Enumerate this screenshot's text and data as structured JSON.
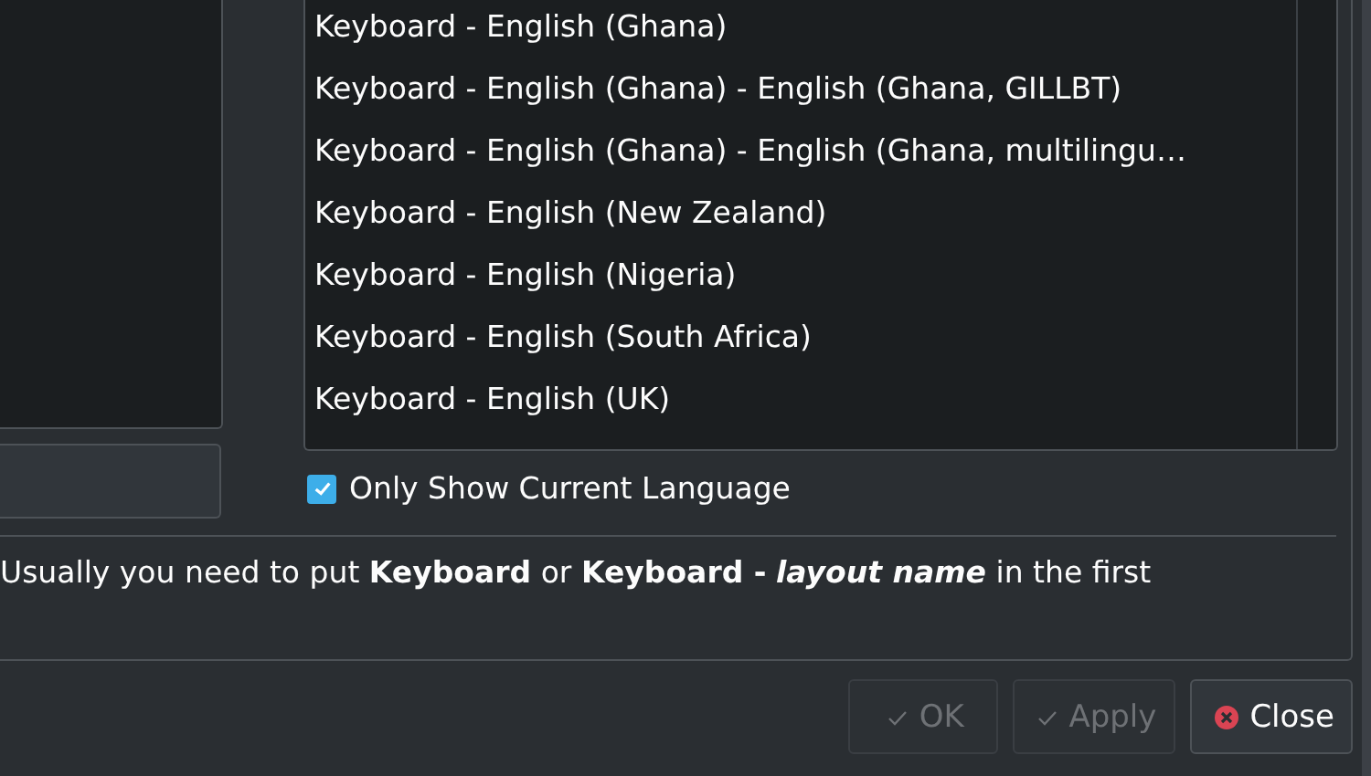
{
  "layout_list": {
    "items": [
      {
        "label": "Keyboard - English (Ghana)",
        "selected": false
      },
      {
        "label": "Keyboard - English (Ghana) - English (Ghana, GILLBT)",
        "selected": false
      },
      {
        "label": "Keyboard - English (Ghana) - English (Ghana, multilingu…",
        "selected": false
      },
      {
        "label": "Keyboard - English (New Zealand)",
        "selected": false
      },
      {
        "label": "Keyboard - English (Nigeria)",
        "selected": false
      },
      {
        "label": "Keyboard - English (South Africa)",
        "selected": false
      },
      {
        "label": "Keyboard - English (UK)",
        "selected": false
      }
    ]
  },
  "only_current_language": {
    "label": "Only Show Current Language",
    "checked": true
  },
  "hint": "Usually you need to put **Keyboard** or **Keyboard -** *layout name* in the first",
  "buttons": [
    {
      "label": "OK",
      "kind": "check",
      "disabled": true
    },
    {
      "label": "Apply",
      "kind": "check",
      "disabled": true
    },
    {
      "label": "Close",
      "kind": "close",
      "disabled": false
    }
  ]
}
